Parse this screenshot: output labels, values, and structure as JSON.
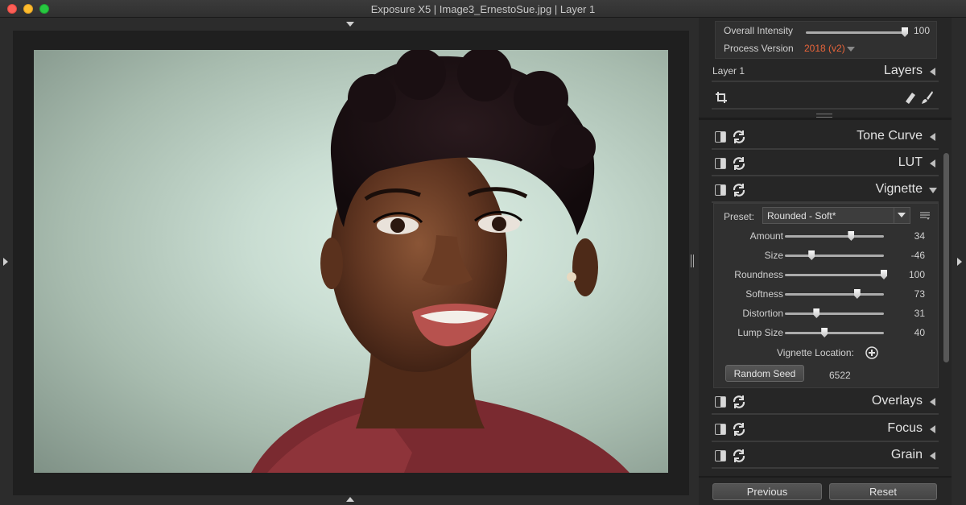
{
  "window": {
    "title": "Exposure X5 | Image3_ErnestoSue.jpg | Layer 1"
  },
  "top_panel": {
    "overall_intensity_label": "Overall Intensity",
    "overall_intensity_value": "100",
    "overall_intensity_fraction": 1.0,
    "process_version_label": "Process Version",
    "process_version_value": "2018 (v2)",
    "accent_color": "#e8643a"
  },
  "layers": {
    "current": "Layer 1",
    "title": "Layers"
  },
  "sections": {
    "tone_curve": "Tone Curve",
    "lut": "LUT",
    "vignette": "Vignette",
    "overlays": "Overlays",
    "focus": "Focus",
    "grain": "Grain"
  },
  "vignette": {
    "preset_label": "Preset:",
    "preset_value": "Rounded - Soft*",
    "sliders": [
      {
        "label": "Amount",
        "value": "34",
        "fraction": 0.67
      },
      {
        "label": "Size",
        "value": "-46",
        "fraction": 0.27
      },
      {
        "label": "Roundness",
        "value": "100",
        "fraction": 1.0
      },
      {
        "label": "Softness",
        "value": "73",
        "fraction": 0.73
      },
      {
        "label": "Distortion",
        "value": "31",
        "fraction": 0.32
      },
      {
        "label": "Lump Size",
        "value": "40",
        "fraction": 0.4
      }
    ],
    "location_label": "Vignette Location:",
    "random_seed_button": "Random Seed",
    "random_seed_value": "6522"
  },
  "footer": {
    "previous": "Previous",
    "reset": "Reset"
  }
}
